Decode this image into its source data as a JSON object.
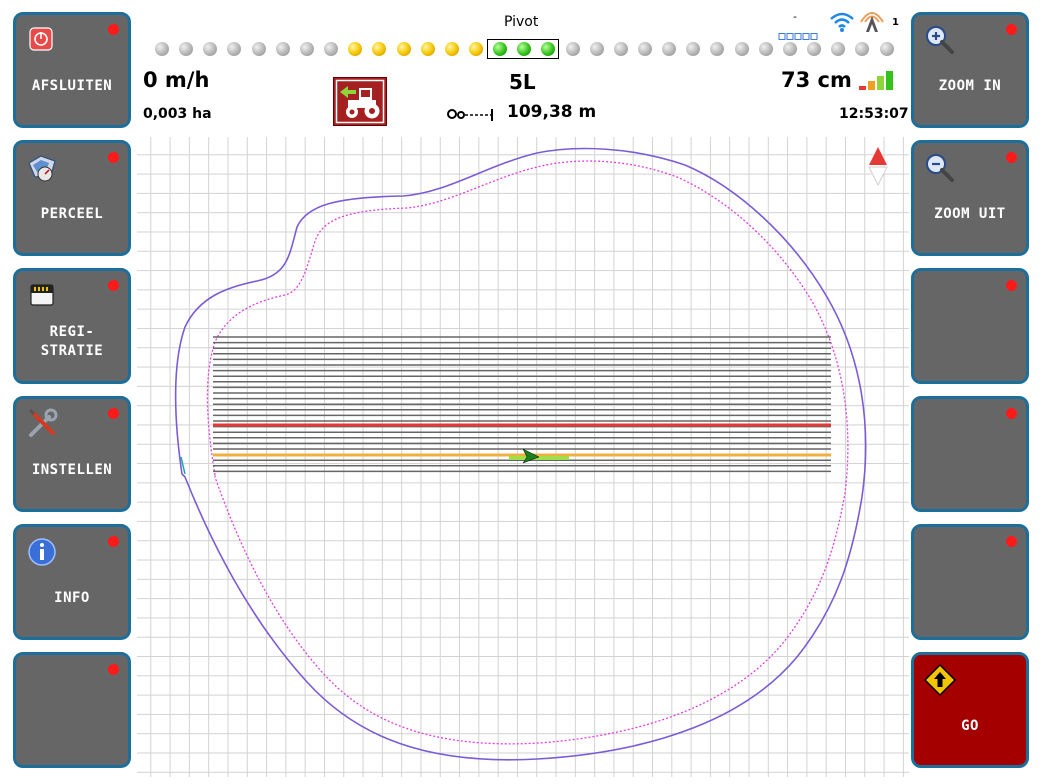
{
  "left_buttons": [
    {
      "label": "AFSLUITEN",
      "icon": "power-icon"
    },
    {
      "label": "PERCEEL",
      "icon": "field-icon"
    },
    {
      "label": "REGI-\nSTRATIE",
      "icon": "sd-card-icon"
    },
    {
      "label": "INSTELLEN",
      "icon": "wrench-screwdriver-icon"
    },
    {
      "label": "INFO",
      "icon": "info-icon"
    },
    {
      "label": "",
      "icon": ""
    }
  ],
  "right_buttons": [
    {
      "label": "ZOOM IN",
      "icon": "zoom-in-icon"
    },
    {
      "label": "ZOOM UIT",
      "icon": "zoom-out-icon"
    },
    {
      "label": "",
      "icon": ""
    },
    {
      "label": "",
      "icon": ""
    },
    {
      "label": "",
      "icon": ""
    },
    {
      "label": "GO",
      "icon": "go-arrow-icon"
    }
  ],
  "status": {
    "pivot_label": "Pivot",
    "leds": [
      "grey",
      "grey",
      "grey",
      "grey",
      "grey",
      "grey",
      "grey",
      "grey",
      "yellow",
      "yellow",
      "yellow",
      "yellow",
      "yellow",
      "yellow",
      "green",
      "green",
      "green",
      "grey",
      "grey",
      "grey",
      "grey",
      "grey",
      "grey",
      "grey",
      "grey",
      "grey",
      "grey",
      "grey",
      "grey",
      "grey",
      "grey"
    ],
    "speed": "0 m/h",
    "area": "0,003 ha",
    "lane": "5L",
    "implement_distance": "109,38 m",
    "accuracy": "73 cm",
    "time": "12:53:07",
    "satellite_dash": "-",
    "satellite_count": "1",
    "signal_bars_active": 4
  },
  "colors": {
    "button_grey": "#666666",
    "button_border": "#1c6f9a",
    "go_red": "#a40000",
    "led_red": "#ff1a1a",
    "boundary_outer": "#7b5cd6",
    "boundary_inner": "#e040e0",
    "guide_line": "#666666",
    "active_line": "#e53935",
    "current_line": "#f0b040"
  }
}
